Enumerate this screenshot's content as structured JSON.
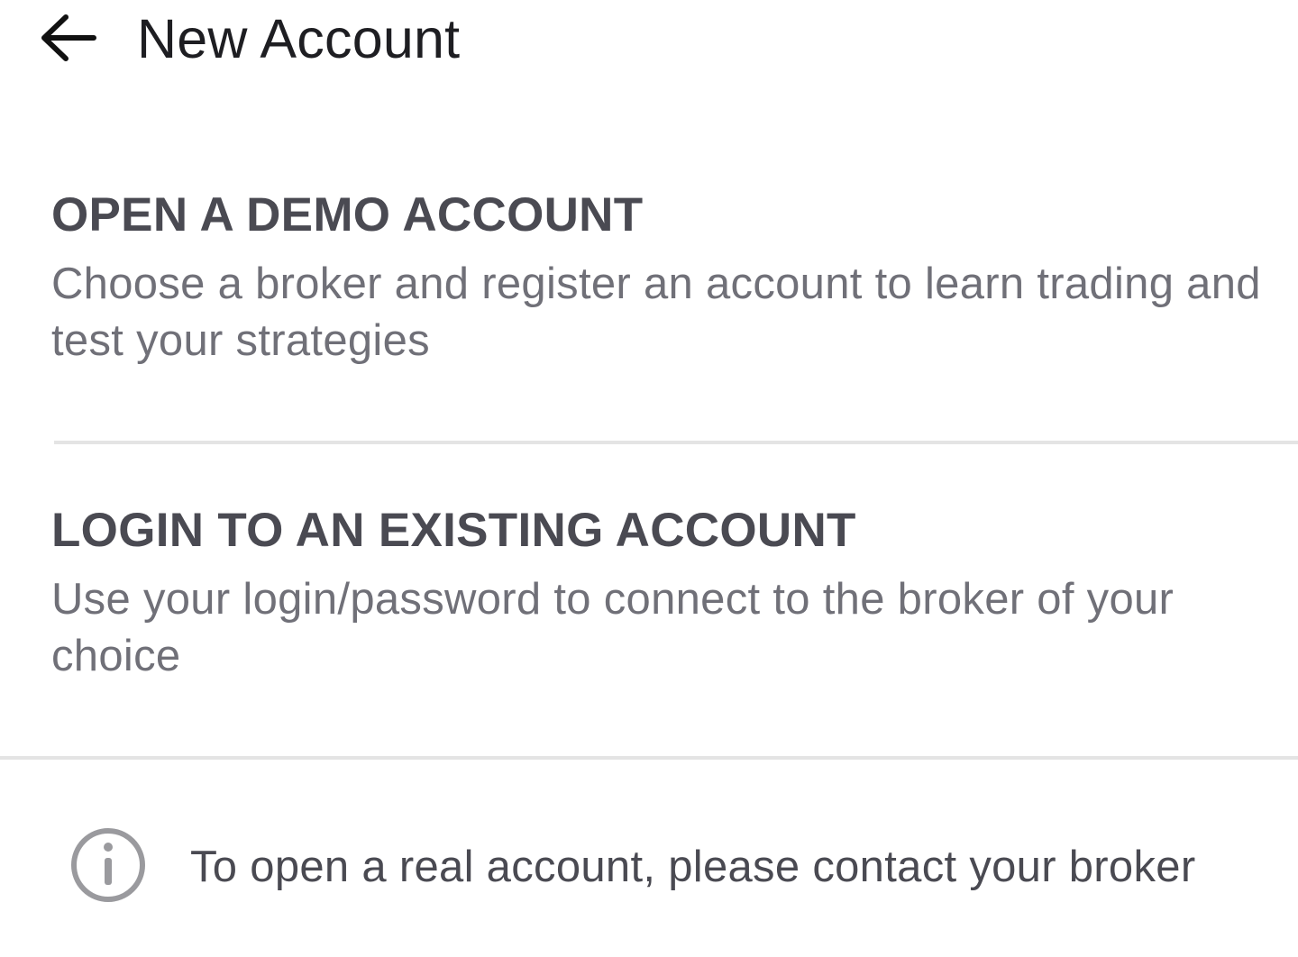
{
  "header": {
    "back_icon": "arrow-left-icon",
    "title": "New Account"
  },
  "options": [
    {
      "title": "OPEN A DEMO ACCOUNT",
      "description": "Choose a broker and register an account to learn trading and test your strategies"
    },
    {
      "title": "LOGIN TO AN EXISTING ACCOUNT",
      "description": "Use your login/password to connect to the broker of your choice"
    }
  ],
  "info": {
    "icon": "info-icon",
    "text": "To open a real account, please contact your broker"
  },
  "colors": {
    "background": "#ffffff",
    "title_text": "#1e1e22",
    "option_title": "#4a4a52",
    "option_description": "#707078",
    "divider": "#e4e4e4",
    "info_icon": "#9a9a9e"
  }
}
